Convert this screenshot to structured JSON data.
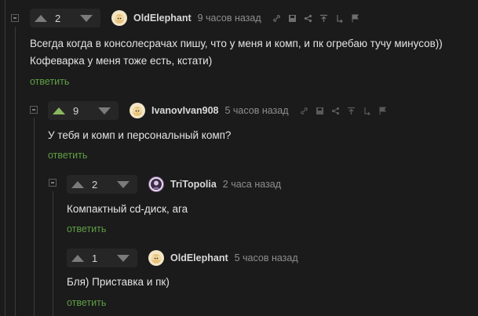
{
  "comments": [
    {
      "vote_count": "2",
      "username": "OldElephant",
      "time": "9 часов назад",
      "lines": [
        "Всегда когда в консолесрачах пишу, что у меня и комп, и пк огребаю тучу минусов))",
        "Кофеварка у меня тоже есть, кстати)"
      ],
      "reply_label": "ответить",
      "tool_icons": [
        "link-icon",
        "save-icon",
        "share-icon",
        "pin-icon",
        "reply-to-icon",
        "flag-icon"
      ]
    },
    {
      "vote_count": "9",
      "username": "IvanovIvan908",
      "time": "5 часов назад",
      "lines": [
        "У тебя и комп и персональный комп?"
      ],
      "reply_label": "ответить",
      "tool_icons": [
        "link-icon",
        "save-icon",
        "share-icon",
        "pin-icon",
        "reply-to-icon",
        "flag-icon"
      ]
    },
    {
      "vote_count": "2",
      "username": "TriTopolia",
      "time": "2 часа назад",
      "lines": [
        "Компактный cd-диск, ага"
      ],
      "reply_label": "ответить"
    },
    {
      "vote_count": "1",
      "username": "OldElephant",
      "time": "5 часов назад",
      "lines": [
        "Бля) Приставка и пк)"
      ],
      "reply_label": "ответить"
    }
  ],
  "colors": {
    "background": "#1b1b1b",
    "upvote_active": "#8ab85c",
    "reply_link": "#5f9f44"
  }
}
